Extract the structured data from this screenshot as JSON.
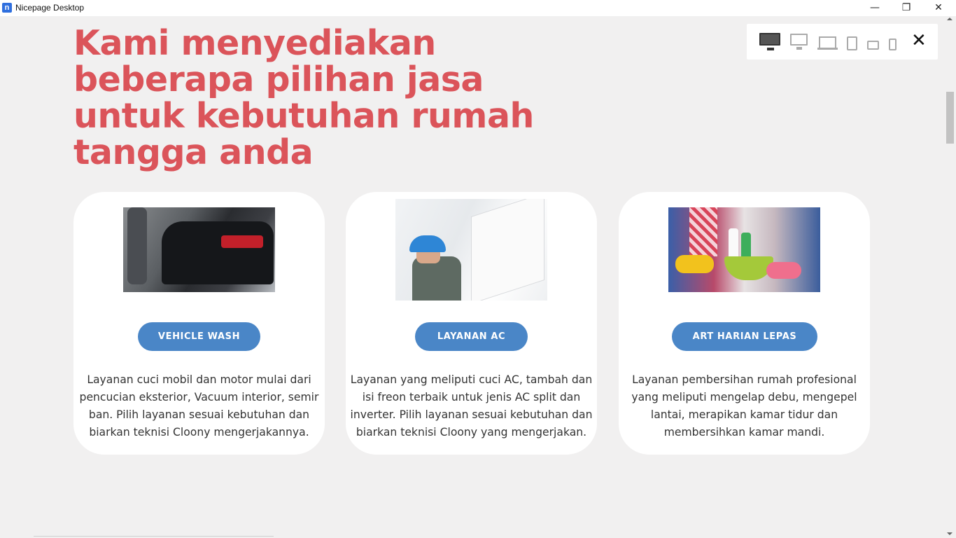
{
  "window": {
    "app_icon_letter": "n",
    "title": "Nicepage Desktop",
    "minimize_glyph": "—",
    "maximize_glyph": "❐",
    "close_glyph": "✕"
  },
  "page": {
    "title": "Kami menyediakan beberapa pilihan jasa untuk kebutuhan rumah tangga anda",
    "colors": {
      "title": "#db545a",
      "button": "#4a86c7",
      "background": "#f1f0f0"
    }
  },
  "device_toolbar": {
    "devices": [
      "desktop-icon",
      "monitor-icon",
      "laptop-icon",
      "tablet-icon",
      "tablet-landscape-icon",
      "phone-icon"
    ],
    "close_glyph": "✕"
  },
  "cards": [
    {
      "image": "car-wash-photo",
      "button": "VEHICLE WASH",
      "description": "Layanan cuci mobil dan motor mulai dari pencucian eksterior, Vacuum interior, semir ban. Pilih layanan sesuai kebutuhan dan biarkan teknisi Cloony mengerjakannya."
    },
    {
      "image": "ac-service-photo",
      "button": "LAYANAN AC",
      "description": "Layanan yang meliputi cuci AC, tambah dan isi freon terbaik untuk jenis AC split dan inverter. Pilih layanan sesuai kebutuhan dan biarkan teknisi Cloony yang mengerjakan."
    },
    {
      "image": "cleaning-photo",
      "button": "ART HARIAN LEPAS",
      "description": "Layanan pembersihan rumah profesional yang meliputi mengelap debu, mengepel lantai, merapikan kamar tidur dan membersihkan kamar mandi."
    }
  ]
}
